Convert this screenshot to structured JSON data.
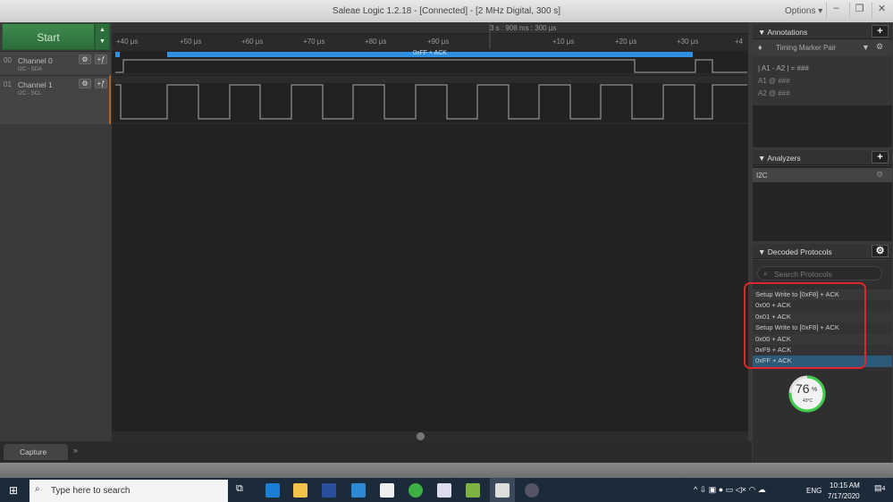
{
  "window": {
    "title": "Saleae Logic 1.2.18 - [Connected] - [2 MHz Digital, 300 s]",
    "options": "Options ▾",
    "minimize": "–",
    "restore": "❐",
    "close": "✕"
  },
  "toolbar": {
    "start": "Start"
  },
  "channels": [
    {
      "num": "00",
      "name": "Channel 0",
      "sub": "I2C - SDA"
    },
    {
      "num": "01",
      "name": "Channel 1",
      "sub": "I2C - SCL"
    }
  ],
  "ruler": {
    "time": "3 s : 908 ms : 300 μs",
    "ticks": [
      "+40 μs",
      "+50 μs",
      "+60 μs",
      "+70 μs",
      "+80 μs",
      "+90 μs",
      "+10 μs",
      "+20 μs",
      "+30 μs",
      "+4"
    ]
  },
  "decoded_bar": "0xFF + ACK",
  "annotations": {
    "title": "Annotations",
    "marker": "Timing Marker Pair",
    "line1": "| A1 - A2 | = ###",
    "line2": "A1 @ ###",
    "line3": "A2 @ ###"
  },
  "analyzers": {
    "title": "Analyzers",
    "items": [
      "I2C"
    ]
  },
  "decoded": {
    "title": "Decoded Protocols",
    "search_placeholder": "Search Protocols",
    "items": [
      "Setup Write to [0xF8] + ACK",
      "0x00 + ACK",
      "0x01 + ACK",
      "Setup Write to [0xF8] + ACK",
      "0x00 + ACK",
      "0xF9 + ACK",
      "0xFF + ACK"
    ],
    "selected": 6
  },
  "gauge": {
    "percent": "76",
    "unit": "%",
    "temp": "43°C",
    "fraction": 0.76
  },
  "tabs": {
    "capture": "Capture",
    "more": "»"
  },
  "taskbar": {
    "search": "Type here to search",
    "time": "10:15 AM",
    "date": "7/17/2020",
    "lang": "ENG",
    "notifications": "4"
  },
  "colors": {
    "accent": "#2f8fe0",
    "start": "#3f8a4f",
    "highlight": "#e0262b",
    "selected": "#2d5a78"
  }
}
